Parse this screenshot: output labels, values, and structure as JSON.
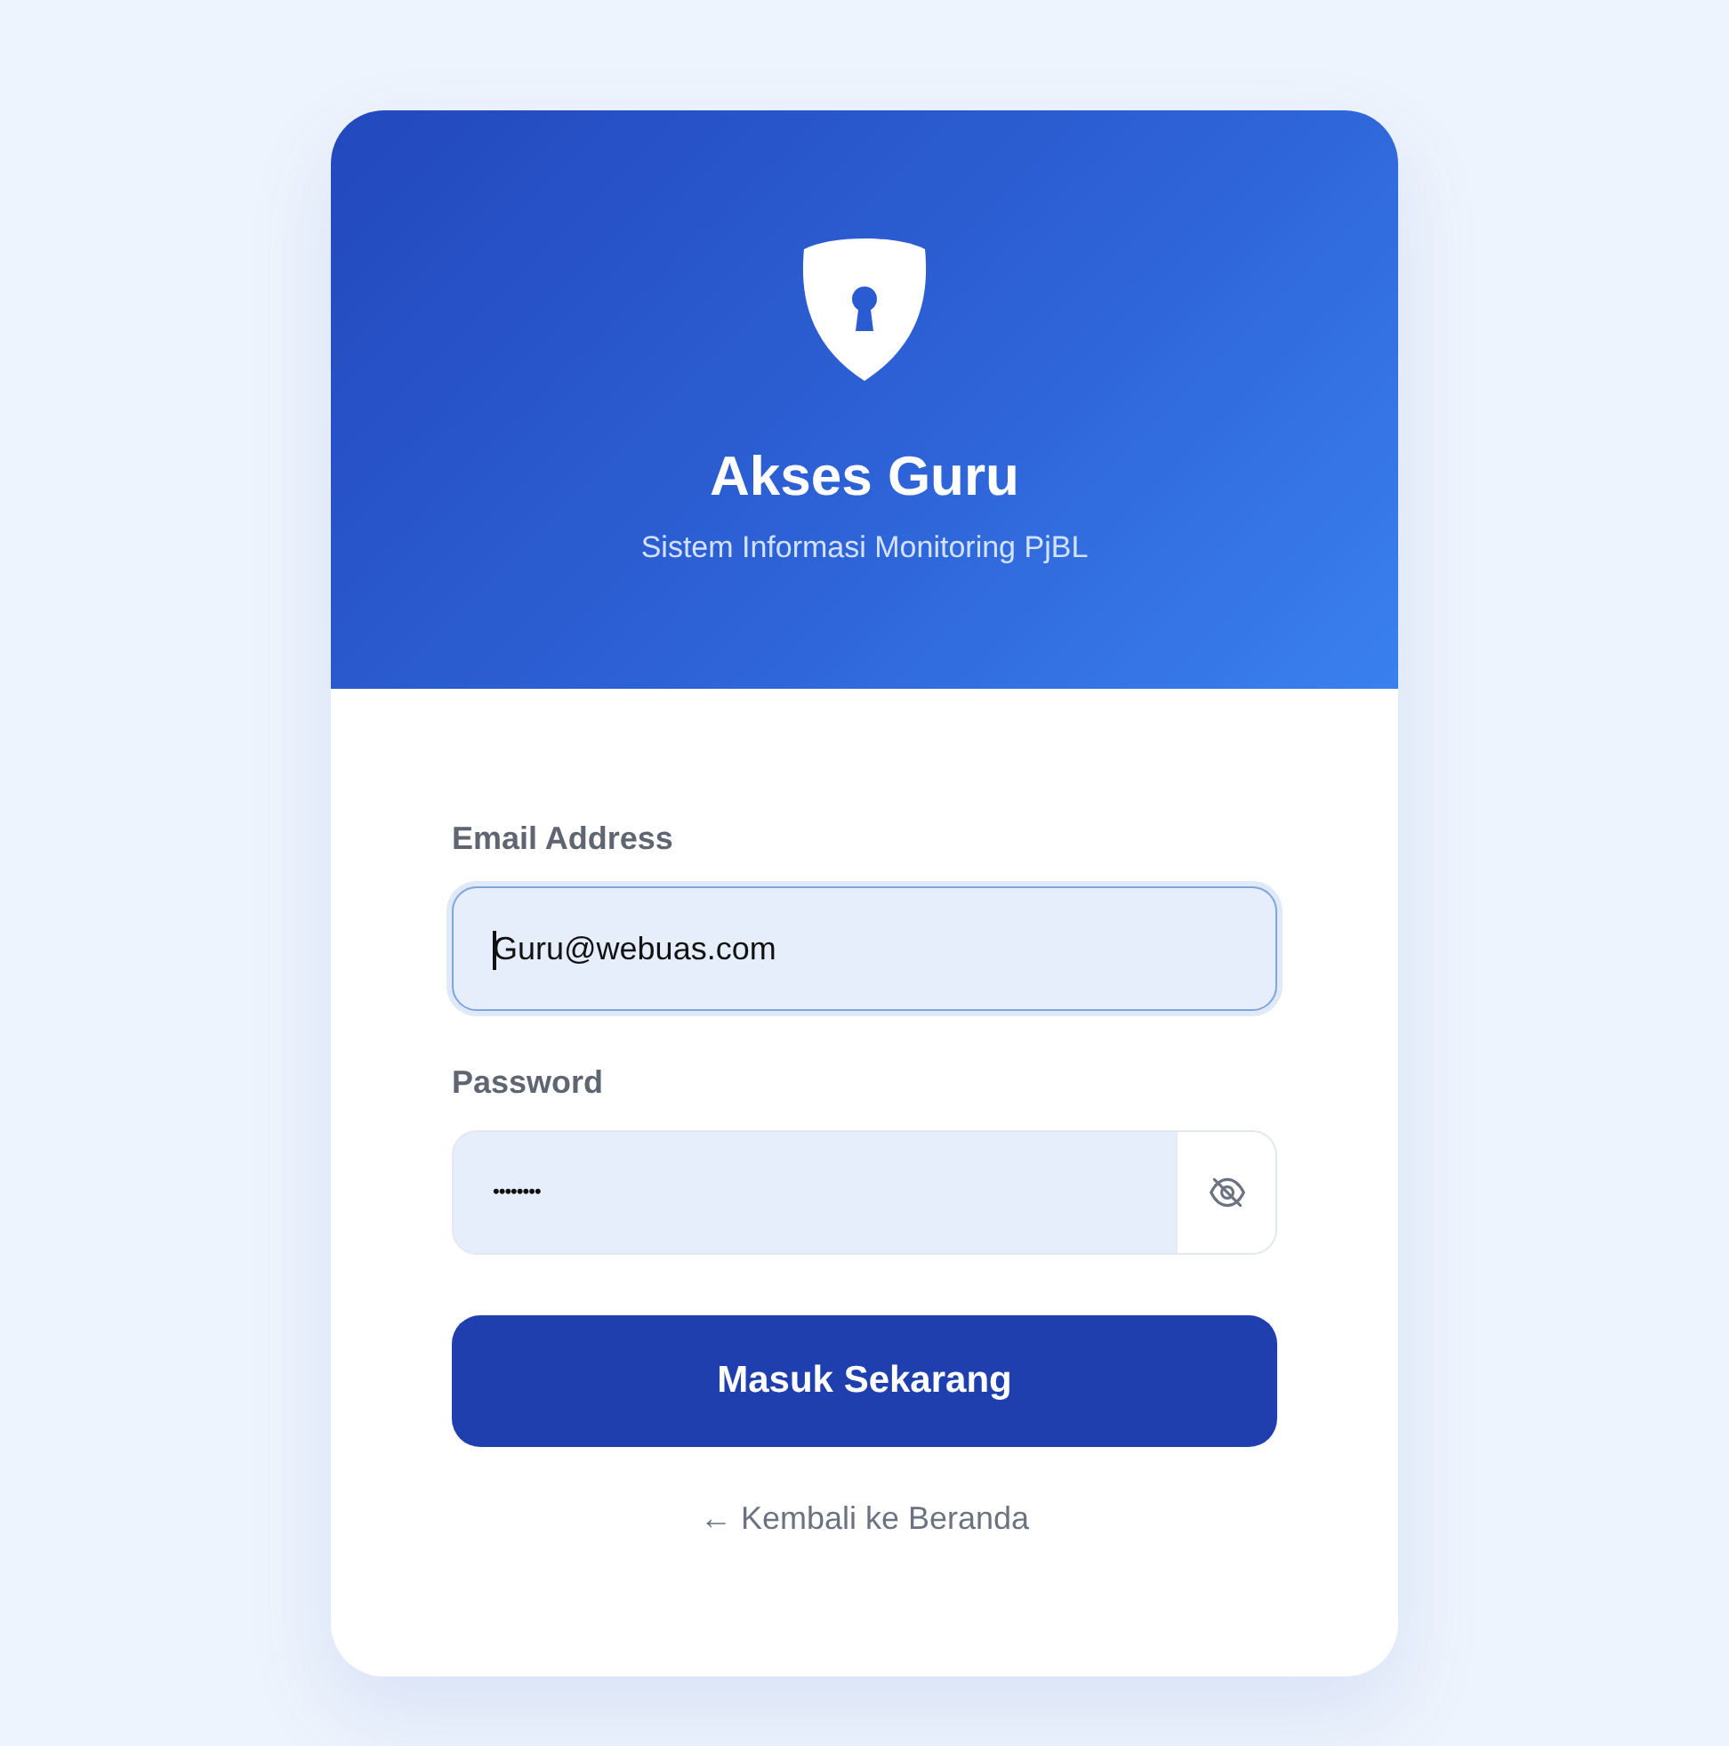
{
  "header": {
    "title": "Akses Guru",
    "subtitle": "Sistem Informasi Monitoring PjBL"
  },
  "fields": [
    {
      "kind": "email",
      "label": "Email Address",
      "value": "Guru@webuas.com",
      "focused": true
    },
    {
      "kind": "password",
      "label": "Password",
      "value": "••••••••",
      "focused": false
    }
  ],
  "submit_button": "Masuk Sekarang",
  "back_link": "← Kembali ke Beranda"
}
